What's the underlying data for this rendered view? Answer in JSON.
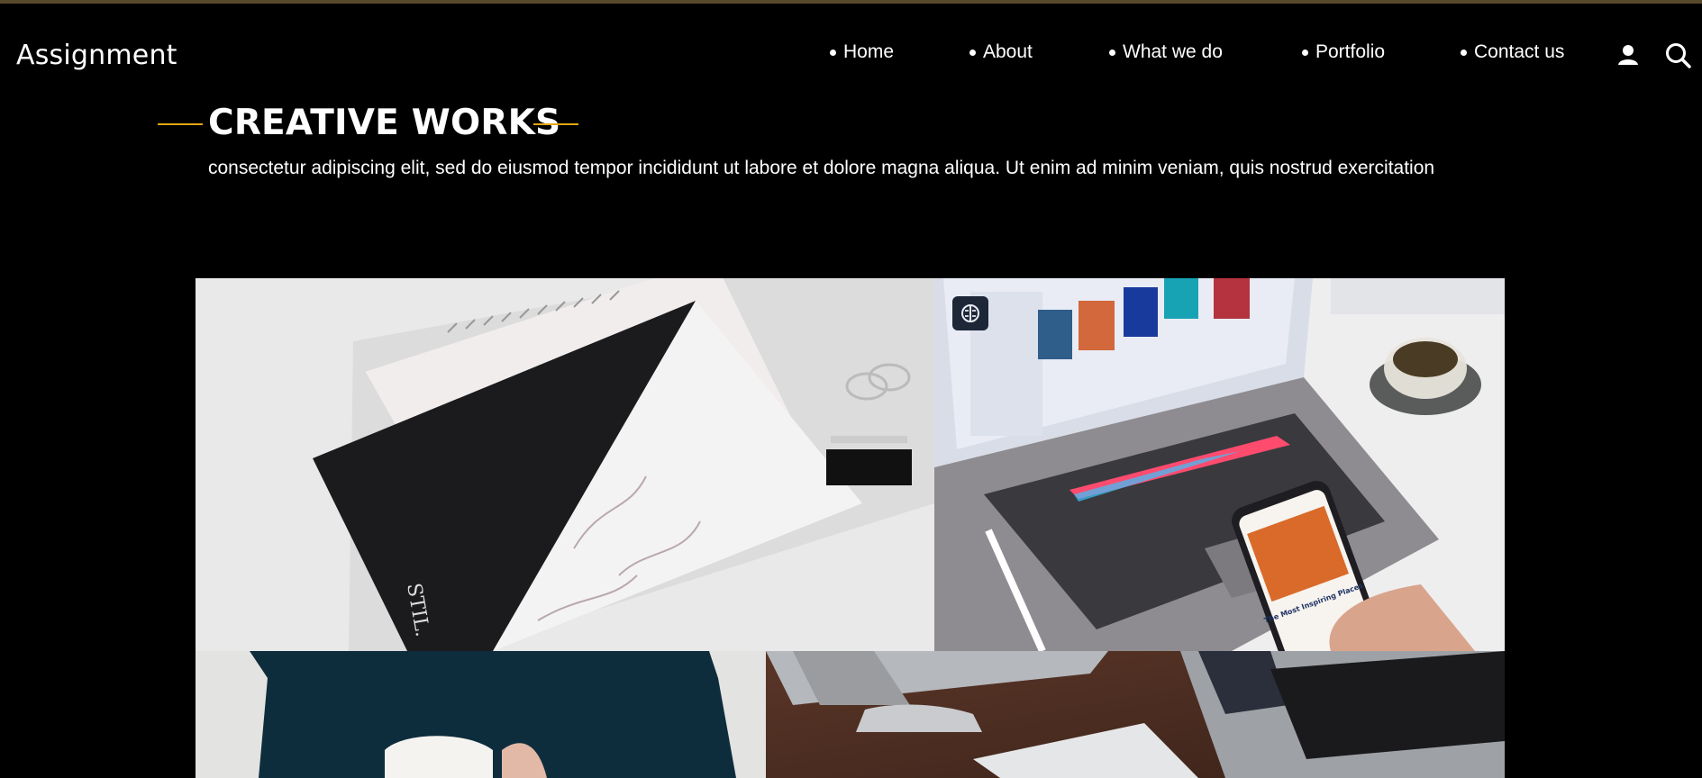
{
  "brand": {
    "name": "Assignment"
  },
  "nav": {
    "items": [
      {
        "label": "Home"
      },
      {
        "label": "About"
      },
      {
        "label": "What we do"
      },
      {
        "label": "Portfolio"
      },
      {
        "label": "Contact us"
      }
    ],
    "icons": [
      "user-icon",
      "search-icon"
    ]
  },
  "section": {
    "title": "CREATIVE WORKS",
    "description": "consectetur adipiscing elit, sed do eiusmod tempor incididunt ut labore et dolore magna aliqua. Ut enim ad minim veniam, quis nostrud exercitation"
  },
  "portfolio": {
    "items": [
      {
        "icon": "stationery-mockup-image",
        "text": "STIL."
      },
      {
        "icon": "laptop-phone-image",
        "text": "The Most Inspiring Places"
      },
      {
        "icon": "person-with-mug-image"
      },
      {
        "icon": "imac-and-laptop-image"
      }
    ]
  },
  "colors": {
    "accent": "#e5a514",
    "background": "#000000",
    "badge": "#1e2738"
  }
}
